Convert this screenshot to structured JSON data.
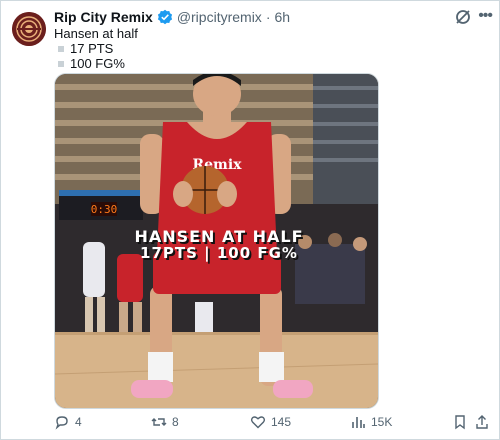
{
  "tweet": {
    "author_name": "Rip City Remix",
    "handle": "@ripcityremix",
    "separator": "·",
    "time": "6h",
    "lines": [
      "Hansen at half",
      "17 PTS",
      "100 FG%"
    ]
  },
  "media": {
    "jersey_text": "Remix",
    "scoreboard_text": "0:30",
    "overlay_line1": "HANSEN AT HALF",
    "overlay_line2": "17PTS | 100 FG%"
  },
  "actions": {
    "replies": "4",
    "reposts": "8",
    "likes": "145",
    "views": "15K"
  },
  "colors": {
    "accent": "#1d9bf0",
    "text": "#0f1419",
    "muted": "#536471",
    "jersey_red": "#c8232b"
  },
  "icons": [
    "verified-badge-icon",
    "grok-icon",
    "more-icon",
    "reply-icon",
    "repost-icon",
    "like-icon",
    "views-icon",
    "bookmark-icon",
    "share-icon"
  ]
}
